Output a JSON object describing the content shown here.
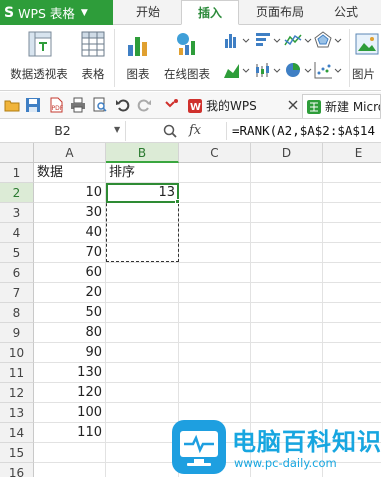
{
  "app": {
    "title": "WPS 表格",
    "logo_letter": "S"
  },
  "ribbon_tabs": [
    {
      "label": "开始",
      "active": false
    },
    {
      "label": "插入",
      "active": true
    },
    {
      "label": "页面布局",
      "active": false
    },
    {
      "label": "公式",
      "active": false
    }
  ],
  "ribbon_buttons": {
    "pivot": "数据透视表",
    "table": "表格",
    "chart": "图表",
    "online_chart": "在线图表",
    "picture": "图片"
  },
  "doc_tabs": [
    {
      "label": "我的WPS"
    },
    {
      "label": "新建 Micros"
    }
  ],
  "formula_bar": {
    "name_box": "B2",
    "fx": "fx",
    "formula": "=RANK(A2,$A$2:$A$14"
  },
  "columns": [
    "A",
    "B",
    "C",
    "D",
    "E"
  ],
  "rows": [
    "1",
    "2",
    "3",
    "4",
    "5",
    "6",
    "7",
    "8",
    "9",
    "10",
    "11",
    "12",
    "13",
    "14",
    "15",
    "16"
  ],
  "sheet": {
    "header_a": "数据",
    "header_b": "排序",
    "values": [
      10,
      30,
      40,
      70,
      60,
      20,
      50,
      80,
      90,
      130,
      120,
      100,
      110
    ],
    "b2": "13"
  },
  "watermark": {
    "title": "电脑百科知识",
    "url": "www.pc-daily.com"
  },
  "colors": {
    "accent_green": "#2e9d3a",
    "watermark_blue": "#17a6e0"
  }
}
